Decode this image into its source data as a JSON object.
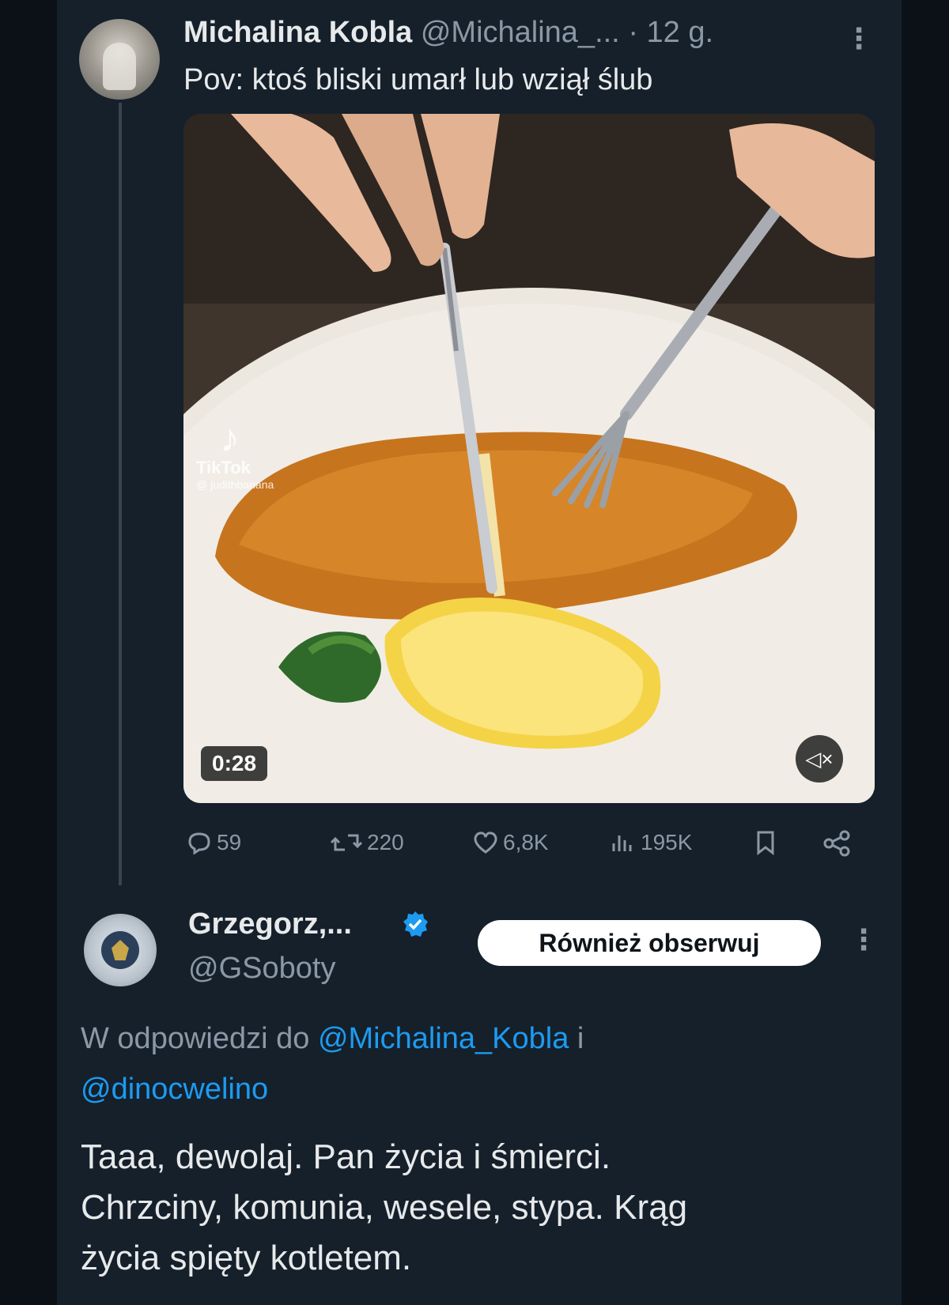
{
  "tweet1": {
    "author_name": "Michalina Kobla",
    "author_handle": "@Michalina_...",
    "time": "· 12 g.",
    "more_icon": "⋮",
    "text": "Pov: ktoś bliski umarł lub wziął ślub",
    "media": {
      "watermark_brand": "TikTok",
      "watermark_user": "@ judithbanana",
      "duration": "0:28",
      "mute_icon": "speaker-muted-icon"
    },
    "stats": {
      "replies": "59",
      "reposts": "220",
      "likes": "6,8K",
      "views": "195K"
    }
  },
  "tweet2": {
    "author_name": "Grzegorz,...",
    "author_handle": "@GSoboty",
    "follow_button": "Również obserwuj",
    "more_icon": "⋮",
    "reply_prefix": "W odpowiedzi do ",
    "reply_mention_1": "@Michalina_Kobla",
    "reply_and": " i",
    "reply_mention_2": "@dinocwelino",
    "body_line_1": "Taaa, dewolaj. Pan życia i śmierci.",
    "body_line_2": "Chrzciny, komunia, wesele, stypa. Krąg",
    "body_line_3": "życia spięty kotletem."
  },
  "colors": {
    "background": "#15202b",
    "text": "#e7e9ea",
    "muted": "#8b98a5",
    "accent": "#1d9bf0"
  }
}
